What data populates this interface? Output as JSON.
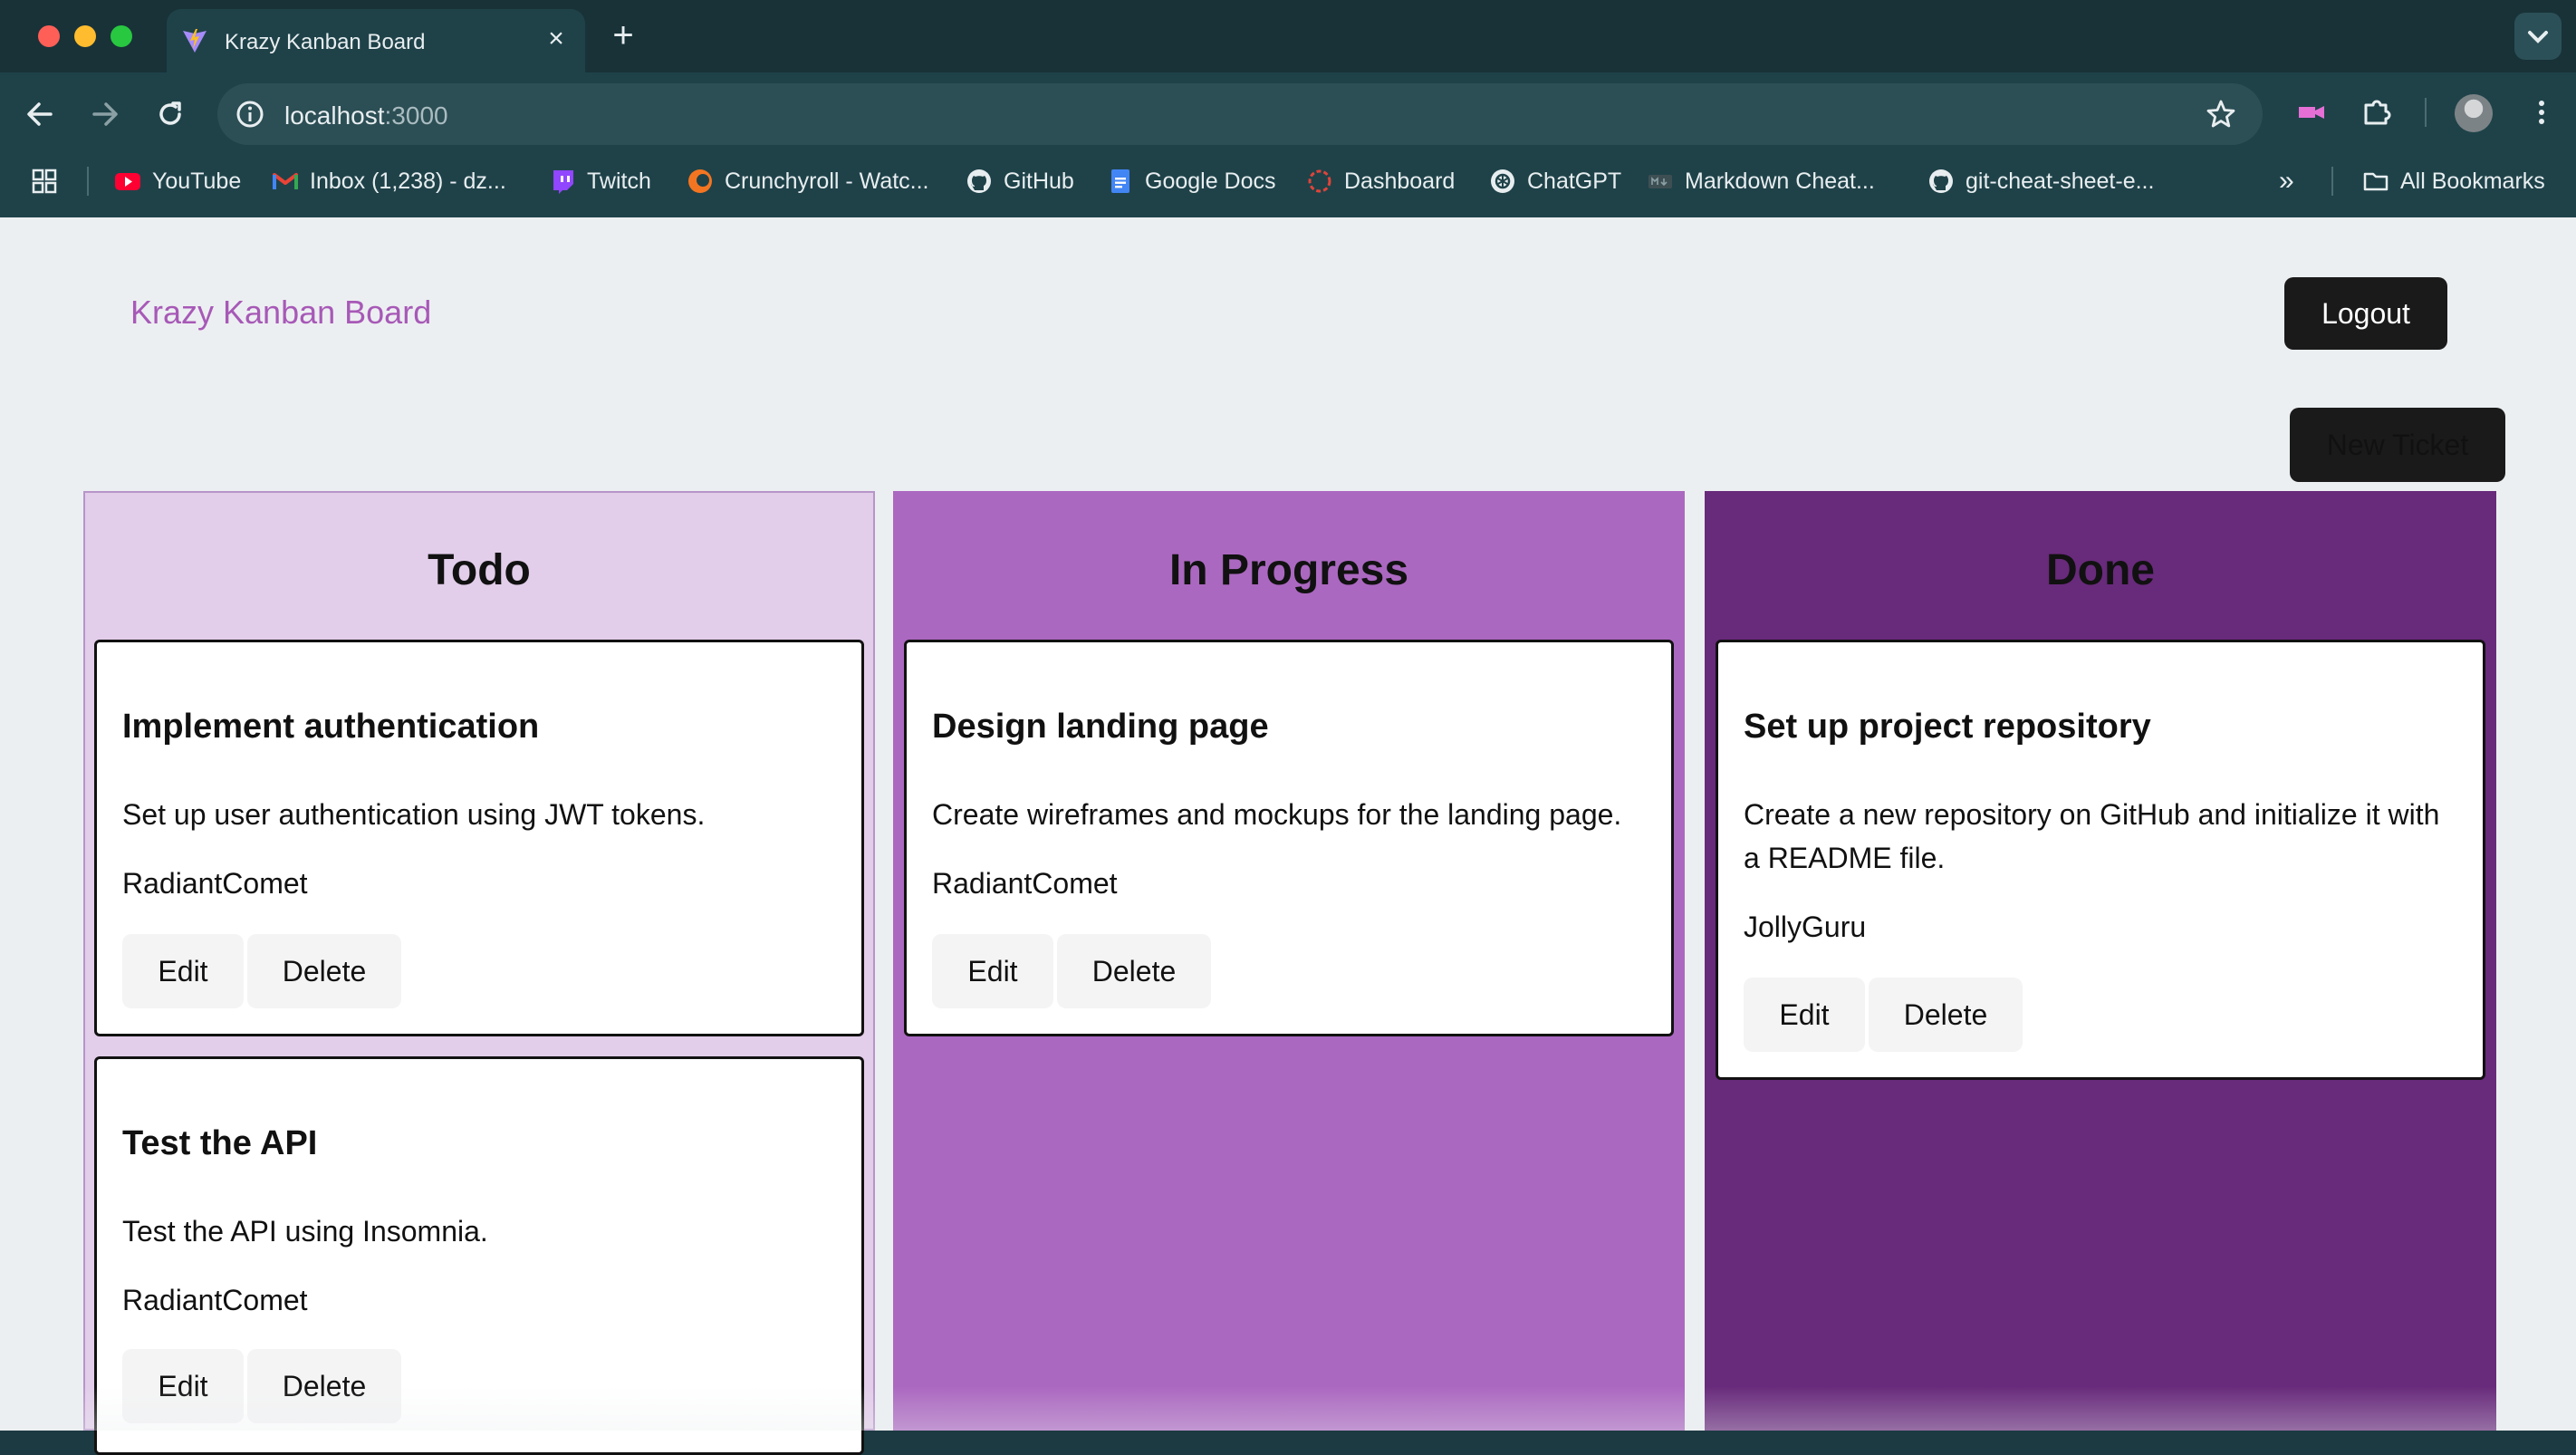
{
  "browser": {
    "tab_title": "Krazy Kanban Board",
    "url_host": "localhost",
    "url_port": ":3000",
    "bookmarks": [
      {
        "label": "YouTube",
        "icon": "youtube-icon"
      },
      {
        "label": "Inbox (1,238) - dz...",
        "icon": "gmail-icon"
      },
      {
        "label": "Twitch",
        "icon": "twitch-icon"
      },
      {
        "label": "Crunchyroll - Watc...",
        "icon": "crunchyroll-icon"
      },
      {
        "label": "GitHub",
        "icon": "github-icon"
      },
      {
        "label": "Google Docs",
        "icon": "google-docs-icon"
      },
      {
        "label": "Dashboard",
        "icon": "dashboard-icon"
      },
      {
        "label": "ChatGPT",
        "icon": "chatgpt-icon"
      },
      {
        "label": "Markdown Cheat...",
        "icon": "markdown-icon"
      },
      {
        "label": "git-cheat-sheet-e...",
        "icon": "github-icon"
      }
    ],
    "all_bookmarks": "All Bookmarks",
    "overflow": "»"
  },
  "app": {
    "brand": "Krazy Kanban Board",
    "logout": "Logout",
    "new_ticket": "New Ticket"
  },
  "columns": [
    {
      "title": "Todo",
      "cards": [
        {
          "title": "Implement authentication",
          "description": "Set up user authentication using JWT tokens.",
          "user": "RadiantComet",
          "edit": "Edit",
          "delete": "Delete"
        },
        {
          "title": "Test the API",
          "description": "Test the API using Insomnia.",
          "user": "RadiantComet",
          "edit": "Edit",
          "delete": "Delete"
        }
      ]
    },
    {
      "title": "In Progress",
      "cards": [
        {
          "title": "Design landing page",
          "description": "Create wireframes and mockups for the landing page.",
          "user": "RadiantComet",
          "edit": "Edit",
          "delete": "Delete"
        }
      ]
    },
    {
      "title": "Done",
      "cards": [
        {
          "title": "Set up project repository",
          "description": "Create a new repository on GitHub and initialize it with a README file.",
          "user": "JollyGuru",
          "edit": "Edit",
          "delete": "Delete"
        }
      ]
    }
  ],
  "colors": {
    "todo": "#e2cdea",
    "in_progress": "#ab68c0",
    "done": "#682a7b",
    "brand": "#a759b7"
  }
}
